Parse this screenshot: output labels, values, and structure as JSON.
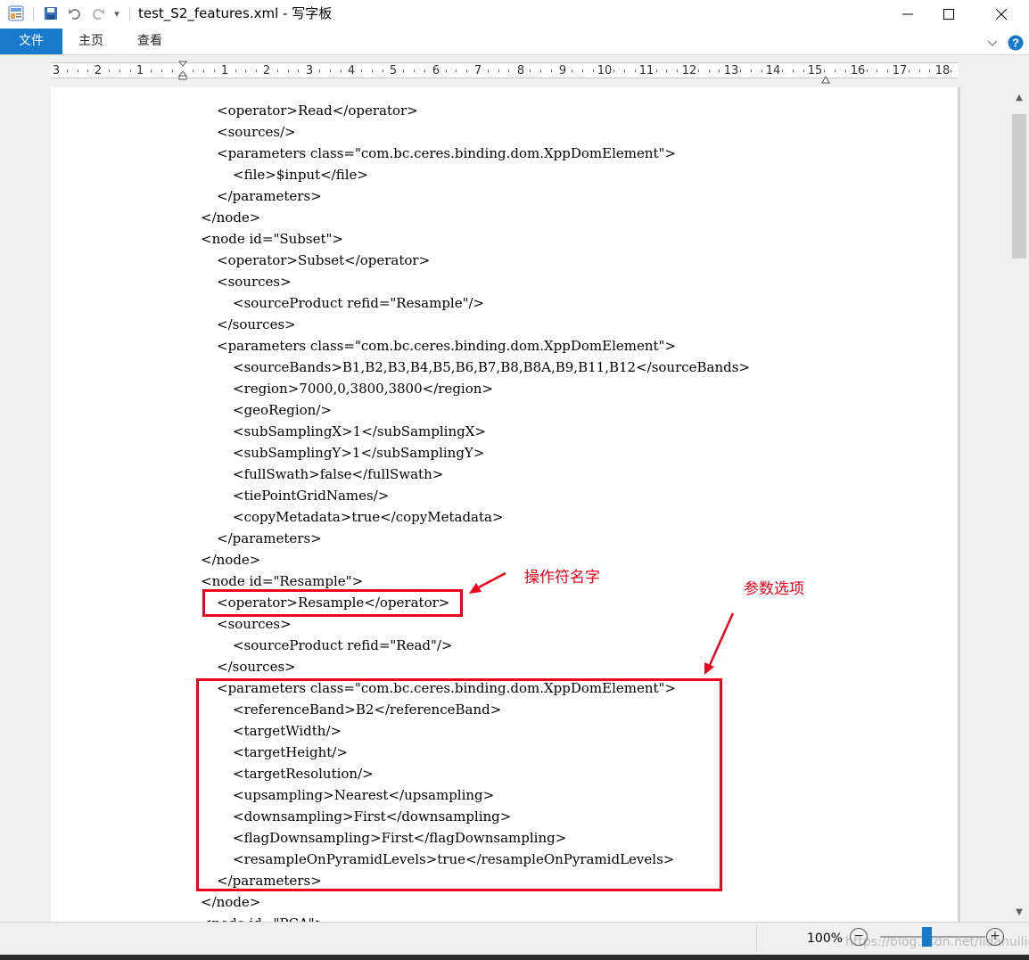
{
  "window": {
    "title": "test_S2_features.xml - 写字板",
    "qa_customize_glyph": "▾"
  },
  "ribbon": {
    "tabs": [
      {
        "label": "文件"
      },
      {
        "label": "主页"
      },
      {
        "label": "查看"
      }
    ]
  },
  "ruler": {
    "labels": [
      "3",
      "2",
      "1",
      "1",
      "2",
      "3",
      "4",
      "5",
      "6",
      "7",
      "8",
      "9",
      "10",
      "11",
      "12",
      "13",
      "14",
      "15",
      "16",
      "17",
      "18"
    ]
  },
  "document": {
    "lines": [
      "<operator>Read</operator>",
      "<sources/>",
      "<parameters class=\"com.bc.ceres.binding.dom.XppDomElement\">",
      "<file>$input</file>",
      "</parameters>",
      "</node>",
      "<node id=\"Subset\">",
      "<operator>Subset</operator>",
      "<sources>",
      "<sourceProduct refid=\"Resample\"/>",
      "</sources>",
      "<parameters class=\"com.bc.ceres.binding.dom.XppDomElement\">",
      "<sourceBands>B1,B2,B3,B4,B5,B6,B7,B8,B8A,B9,B11,B12</sourceBands>",
      "<region>7000,0,3800,3800</region>",
      "<geoRegion/>",
      "<subSamplingX>1</subSamplingX>",
      "<subSamplingY>1</subSamplingY>",
      "<fullSwath>false</fullSwath>",
      "<tiePointGridNames/>",
      "<copyMetadata>true</copyMetadata>",
      "</parameters>",
      "</node>",
      "<node id=\"Resample\">",
      "<operator>Resample</operator>",
      "<sources>",
      "<sourceProduct refid=\"Read\"/>",
      "</sources>",
      "<parameters class=\"com.bc.ceres.binding.dom.XppDomElement\">",
      "<referenceBand>B2</referenceBand>",
      "<targetWidth/>",
      "<targetHeight/>",
      "<targetResolution/>",
      "<upsampling>Nearest</upsampling>",
      "<downsampling>First</downsampling>",
      "<flagDownsampling>First</flagDownsampling>",
      "<resampleOnPyramidLevels>true</resampleOnPyramidLevels>",
      "</parameters>",
      "</node>",
      "<node id=\"PCA\">"
    ]
  },
  "annotations": {
    "operator_label": "操作符名字",
    "params_label": "参数选项",
    "color": "#f0001c"
  },
  "statusbar": {
    "zoom": "100%",
    "watermark": "https://blog.csdn.net/lidahuilidahui"
  }
}
